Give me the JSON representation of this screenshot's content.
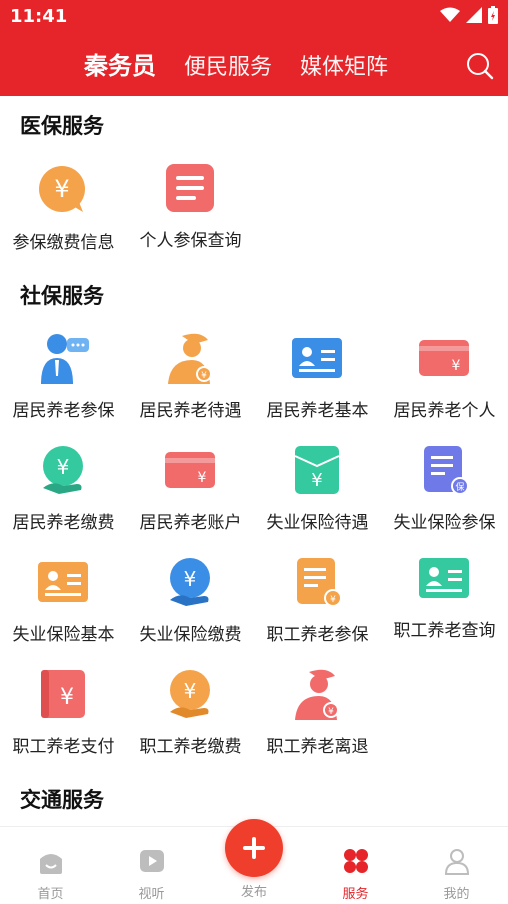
{
  "status": {
    "time": "11:41"
  },
  "header": {
    "tabs": [
      {
        "label": "秦务员",
        "active": true
      },
      {
        "label": "便民服务",
        "active": false
      },
      {
        "label": "媒体矩阵",
        "active": false
      }
    ]
  },
  "sections": {
    "medical": {
      "title": "医保服务",
      "items": [
        "参保缴费信息",
        "个人参保查询"
      ]
    },
    "social": {
      "title": "社保服务",
      "items": [
        "居民养老参保",
        "居民养老待遇",
        "居民养老基本",
        "居民养老个人",
        "居民养老缴费",
        "居民养老账户",
        "失业保险待遇",
        "失业保险参保",
        "失业保险基本",
        "失业保险缴费",
        "职工养老参保",
        "职工养老查询",
        "职工养老支付",
        "职工养老缴费",
        "职工养老离退"
      ]
    },
    "traffic": {
      "title": "交通服务"
    }
  },
  "nav": {
    "home": "首页",
    "video": "视听",
    "publish": "发布",
    "service": "服务",
    "mine": "我的"
  },
  "colors": {
    "brand": "#e5252a",
    "orange": "#f5a34a",
    "red": "#f26b6b",
    "blue": "#3a8ee6",
    "teal": "#35c9a0",
    "purple": "#6f7ae8"
  }
}
